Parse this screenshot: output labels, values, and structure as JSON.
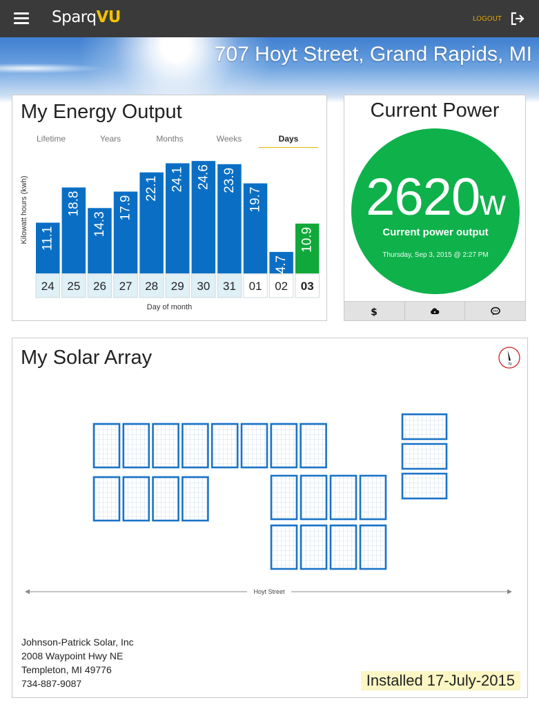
{
  "header": {
    "brand_prefix": "Sparq",
    "brand_suffix": "VU",
    "logout_label": "LOGOUT",
    "menu_icon": "hamburger-menu-icon",
    "logout_icon": "logout-arrow-icon",
    "brand_color": "#f2c200",
    "bar_color": "#3a3a3a"
  },
  "banner": {
    "address": "707 Hoyt Street, Grand Rapids, MI"
  },
  "energy": {
    "title": "My Energy Output",
    "tabs": [
      "Lifetime",
      "Years",
      "Months",
      "Weeks",
      "Days"
    ],
    "active_tab": "Days",
    "chart_data": {
      "type": "bar",
      "ylabel": "Kilowatt hours (kwh)",
      "xlabel": "Day of month",
      "categories": [
        "24",
        "25",
        "26",
        "27",
        "28",
        "29",
        "30",
        "31",
        "01",
        "02",
        "03"
      ],
      "values": [
        11.1,
        18.8,
        14.3,
        17.9,
        22.1,
        24.1,
        24.6,
        23.9,
        19.7,
        4.7,
        10.9
      ],
      "data_labels": [
        "11.1",
        "18.8",
        "14.3",
        "17.9",
        "22.1",
        "24.1",
        "24.6",
        "23.9",
        "19.7",
        "4.7",
        "10.9"
      ],
      "highlighted": "03",
      "bar_color": "#0a6fc4",
      "highlight_color": "#11a83b"
    }
  },
  "power": {
    "title": "Current Power",
    "value": "2620",
    "unit": "w",
    "label": "Current power output",
    "timestamp": "Thursday, Sep 3, 2015 @ 2:27 PM",
    "circle_color": "#0fb14b",
    "tabs": [
      {
        "icon": "dollar-icon"
      },
      {
        "icon": "cloud-icon"
      },
      {
        "icon": "chat-bubble-icon"
      }
    ]
  },
  "array": {
    "title": "My Solar Array",
    "compass_icon": "compass-north-icon",
    "compass_label": "N",
    "street": "Hoyt Street",
    "installer": {
      "name": "Johnson-Patrick Solar, Inc",
      "street": "2008 Waypoint Hwy NE",
      "city": "Templeton, MI 49776",
      "phone": "734-887-9087"
    },
    "installed": "Installed 17-July-2015",
    "panel_color": "#1a73c8"
  }
}
